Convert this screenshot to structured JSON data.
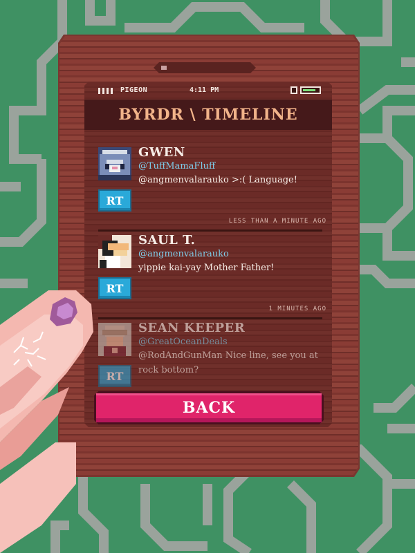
{
  "status_bar": {
    "carrier": "PIGEON",
    "time": "4:11 PM"
  },
  "header": {
    "title": "BYRDR \\ TIMELINE"
  },
  "tweets": [
    {
      "name": "GWEN",
      "handle": "@TuffMamaFluff",
      "message": "@angmenvalarauko >:( Language!",
      "retweet_label": "RT",
      "timestamp": "LESS THAN A MINUTE AGO"
    },
    {
      "name": "SAUL T.",
      "handle": "@angmenvalarauko",
      "message": "yippie kai-yay Mother Father!",
      "retweet_label": "RT",
      "timestamp": "1 MINUTES AGO"
    },
    {
      "name": "SEAN KEEPER",
      "handle": "@GreatOceanDeals",
      "message": "@RodAndGunMan Nice line, see you at rock bottom?",
      "retweet_label": "RT"
    }
  ],
  "back_button": {
    "label": "BACK"
  },
  "colors": {
    "background": "#3f9163",
    "header_text": "#f2b48a",
    "handle_text": "#7ecbe8",
    "retweet_button": "#2aa9d9",
    "back_button": "#e0246a"
  },
  "icons": [
    "signal-bars-icon",
    "battery-icon",
    "avatar-gwen",
    "avatar-saul",
    "avatar-sean",
    "hand-icon"
  ]
}
